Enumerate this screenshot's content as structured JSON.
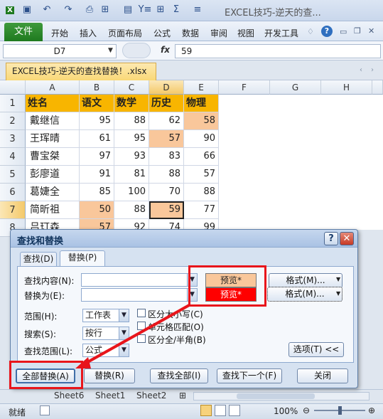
{
  "window": {
    "title": "EXCEL技巧-逆天的查...",
    "quick_access": [
      "save-icon",
      "undo-icon",
      "redo-icon",
      "print-preview-icon",
      "format-icon",
      "paste-icon",
      "filter-icon",
      "borders-icon",
      "sum-icon",
      "align-icon"
    ],
    "quick_access_glyphs": [
      "▣",
      "↶",
      "↷",
      "⎙",
      "⊞",
      "▤",
      "Y≡",
      "⊞",
      "Σ",
      "≡"
    ]
  },
  "ribbon": {
    "file_tab": "文件",
    "tabs": [
      "开始",
      "插入",
      "页面布局",
      "公式",
      "数据",
      "审阅",
      "视图",
      "开发工具"
    ]
  },
  "formula_bar": {
    "name_box": "D7",
    "fx": "fx",
    "value": "59"
  },
  "document_tab": "EXCEL技巧-逆天的查找替换！.xlsx",
  "sheet": {
    "columns": [
      "A",
      "B",
      "C",
      "D",
      "E",
      "F",
      "G",
      "H"
    ],
    "selected_column": "D",
    "selected_row": "7",
    "rows": [
      {
        "num": "1",
        "cells": [
          "姓名",
          "语文",
          "数学",
          "历史",
          "物理"
        ]
      },
      {
        "num": "2",
        "cells": [
          "戴继信",
          "95",
          "88",
          "62",
          "58"
        ]
      },
      {
        "num": "3",
        "cells": [
          "王珲晴",
          "61",
          "95",
          "57",
          "90"
        ]
      },
      {
        "num": "4",
        "cells": [
          "曹宝桀",
          "97",
          "93",
          "83",
          "66"
        ]
      },
      {
        "num": "5",
        "cells": [
          "彭廖道",
          "91",
          "81",
          "88",
          "57"
        ]
      },
      {
        "num": "6",
        "cells": [
          "葛婕全",
          "85",
          "100",
          "70",
          "88"
        ]
      },
      {
        "num": "7",
        "cells": [
          "简昕祖",
          "50",
          "88",
          "59",
          "77"
        ]
      },
      {
        "num": "8",
        "cells": [
          "吕玎森",
          "57",
          "92",
          "74",
          "99"
        ]
      }
    ],
    "highlight_color": "#f9c79b",
    "header_color": "#f8b500"
  },
  "sheet_tabs": [
    "Sheet6",
    "Sheet1",
    "Sheet2"
  ],
  "status": {
    "ready": "就绪",
    "zoom": "100%"
  },
  "dialog": {
    "title": "查找和替换",
    "help": "?",
    "close": "✕",
    "tabs": [
      "查找(D)",
      "替换(P)"
    ],
    "find_label": "查找内容(N):",
    "replace_label": "替换为(E):",
    "find_preview": "预览*",
    "find_preview_color": "#f9c79b",
    "replace_preview": "预览*",
    "replace_preview_color": "#ff0000",
    "format_button_1": "格式(M)...",
    "format_button_2": "格式(M)...",
    "scope_label": "范围(H):",
    "scope_value": "工作表",
    "search_label": "搜索(S):",
    "search_value": "按行",
    "lookin_label": "查找范围(L):",
    "lookin_value": "公式",
    "match_case": "区分大小写(C)",
    "match_cell": "单元格匹配(O)",
    "match_width": "区分全/半角(B)",
    "options_button": "选项(T) <<",
    "replace_all": "全部替换(A)",
    "replace": "替换(R)",
    "find_all": "查找全部(I)",
    "find_next": "查找下一个(F)",
    "close_button": "关闭"
  },
  "annotation": {
    "box_color": "#e8151b",
    "arrow_color": "#e8151b"
  }
}
